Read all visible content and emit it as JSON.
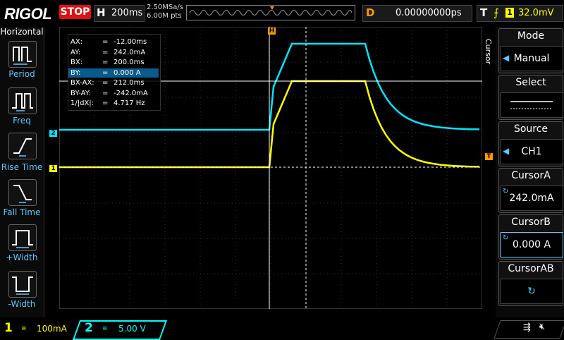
{
  "brand": "RIGOL",
  "status": "STOP",
  "horizontal": {
    "letter": "H",
    "timebase": "200ms",
    "sample_rate": "2.50MSa/s",
    "memory_depth": "6.00M pts"
  },
  "delay": {
    "letter": "D",
    "value": "0.00000000ps"
  },
  "trigger": {
    "letter": "T",
    "source": "1",
    "level": "32.0mV"
  },
  "left_menu": {
    "title": "Horizontal",
    "items": [
      "Period",
      "Freq",
      "Rise Time",
      "Fall Time",
      "+Width",
      "-Width"
    ]
  },
  "measurements": [
    {
      "key": "AX:",
      "value": "-12.00ms"
    },
    {
      "key": "AY:",
      "value": "242.0mA"
    },
    {
      "key": "BX:",
      "value": "200.0ms"
    },
    {
      "key": "BY:",
      "value": "0.000 A"
    },
    {
      "key": "BX-AX:",
      "value": "212.0ms"
    },
    {
      "key": "BY-AY:",
      "value": "-242.0mA"
    },
    {
      "key": "1/|dX|:",
      "value": "4.717 Hz"
    }
  ],
  "right_menu": {
    "side_label": "Cursor",
    "mode": {
      "title": "Mode",
      "value": "Manual"
    },
    "select": {
      "title": "Select"
    },
    "source": {
      "title": "Source",
      "value": "CH1"
    },
    "cursor_a": {
      "title": "CursorA",
      "value": "242.0mA"
    },
    "cursor_b": {
      "title": "CursorB",
      "value": "0.000 A"
    },
    "cursor_ab": {
      "title": "CursorAB"
    }
  },
  "channels": [
    {
      "num": "1",
      "scale": "100mA",
      "color": "#ffff00"
    },
    {
      "num": "2",
      "scale": "5.00 V",
      "color": "#00e5ff"
    }
  ],
  "colors": {
    "ch1": "#ffff00",
    "ch2": "#00e5ff",
    "accent": "#5cc8ff",
    "trigger": "#ff9900"
  }
}
